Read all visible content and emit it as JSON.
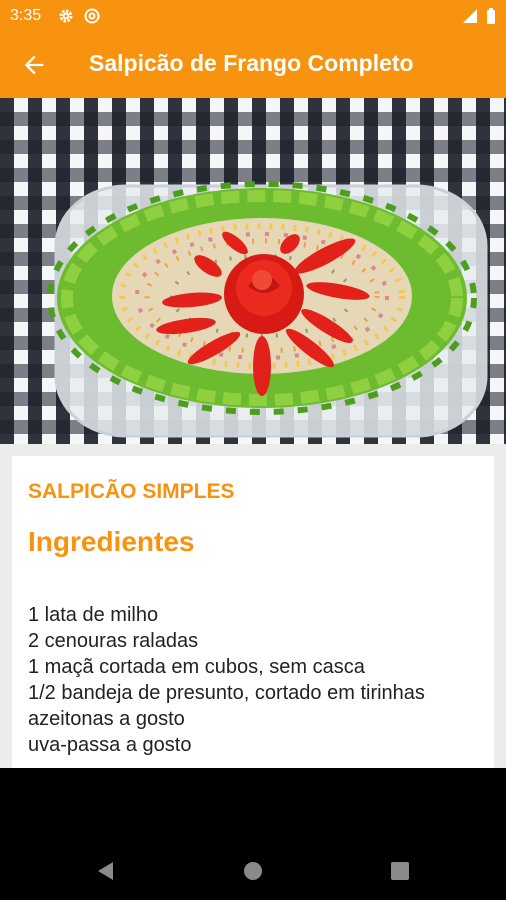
{
  "status_bar": {
    "time": "3:35",
    "icons": [
      "gear-icon",
      "at-sign-icon",
      "signal-icon",
      "battery-icon"
    ]
  },
  "app_bar": {
    "title": "Salpicão de Frango Completo",
    "back_icon": "arrow-left-icon"
  },
  "colors": {
    "accent": "#f7930f",
    "text": "#222222",
    "card_background": "#ffffff",
    "page_background": "#ececec"
  },
  "recipe": {
    "subtitle": "SALPICÃO SIMPLES",
    "section_heading": "Ingredientes",
    "ingredients": [
      "1 lata de milho",
      "2 cenouras raladas",
      "1 maçã cortada em cubos, sem casca",
      "1/2 bandeja de presunto, cortado em tirinhas",
      "azeitonas a gosto",
      "uva-passa a gosto"
    ]
  },
  "nav_bar": {
    "icons": [
      "back-triangle-icon",
      "home-circle-icon",
      "recents-square-icon"
    ]
  }
}
